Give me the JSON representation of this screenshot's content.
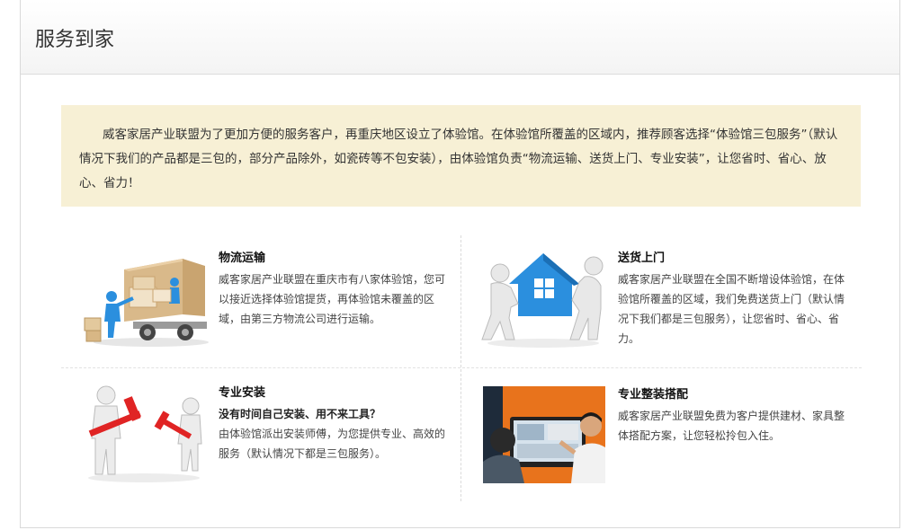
{
  "page_title": "服务到家",
  "intro_text": "威客家居产业联盟为了更加方便的服务客户，再重庆地区设立了体验馆。在体验馆所覆盖的区域内，推荐顾客选择“体验馆三包服务”（默认情况下我们的产品都是三包的，部分产品除外，如瓷砖等不包安装），由体验馆负责“物流运输、送货上门、专业安装”，让您省时、省心、放心、省力！",
  "services": [
    {
      "title": "物流运输",
      "description": "威客家居产业联盟在重庆市有八家体验馆，您可以接近选择体验馆提货，再体验馆未覆盖的区域，由第三方物流公司进行运输。",
      "icon": "delivery-truck-icon"
    },
    {
      "title": "送货上门",
      "description": "威客家居产业联盟在全国不断增设体验馆，在体验馆所覆盖的区域，我们免费送货上门（默认情况下我们都是三包服务），让您省时、省心、省力。",
      "icon": "carry-house-icon"
    },
    {
      "title": "专业安装",
      "subtitle": "没有时间自己安装、用不来工具？",
      "description": "由体验馆派出安装师傅，为您提供专业、高效的服务（默认情况下都是三包服务）。",
      "icon": "hammer-workers-icon"
    },
    {
      "title": "专业整装搭配",
      "description": "威客家居产业联盟免费为客户提供建材、家具整体搭配方案，让您轻松拎包入住。",
      "icon": "consultation-photo-icon"
    }
  ],
  "colors": {
    "intro_background": "#f7f0d5",
    "figure_accent_blue": "#2b8fde",
    "hammer_red": "#e02424",
    "photo_orange": "#e8731c"
  }
}
